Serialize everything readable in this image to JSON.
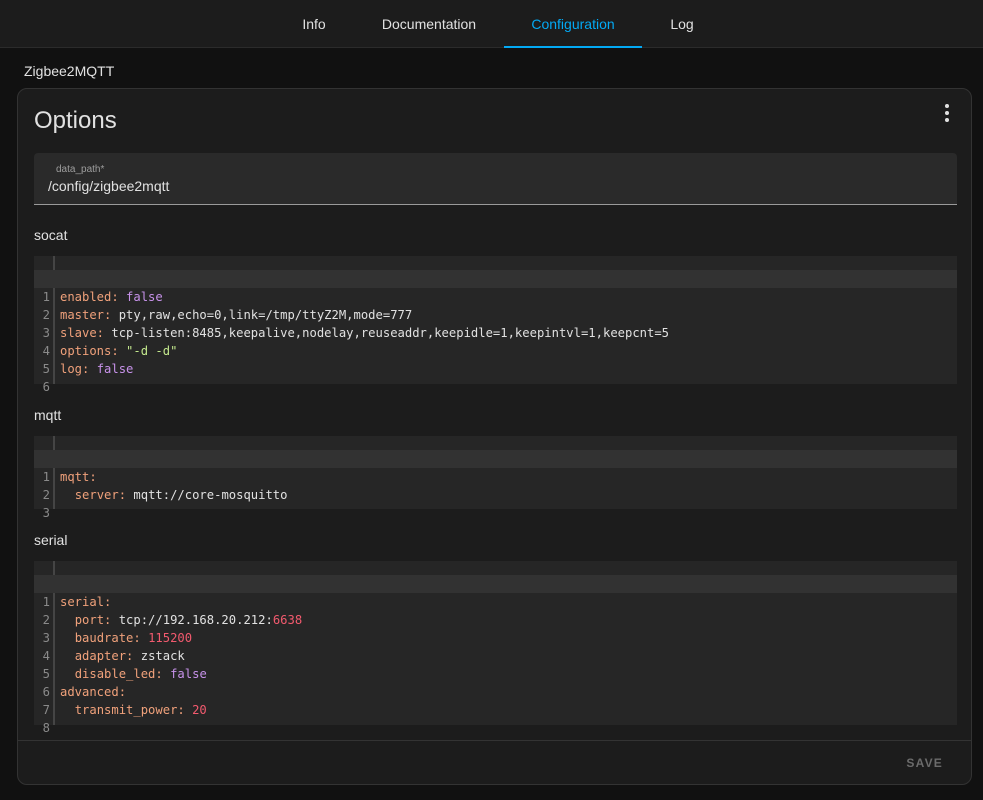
{
  "tabs": [
    {
      "label": "Info",
      "active": false
    },
    {
      "label": "Documentation",
      "active": false
    },
    {
      "label": "Configuration",
      "active": true
    },
    {
      "label": "Log",
      "active": false
    }
  ],
  "addon_name": "Zigbee2MQTT",
  "card": {
    "title": "Options",
    "menu_icon": "dots-vertical-icon",
    "data_path": {
      "label": "data_path*",
      "value": "/config/zigbee2mqtt"
    },
    "sections": [
      {
        "label": "socat",
        "lines": [
          "enabled: false",
          "master: pty,raw,echo=0,link=/tmp/ttyZ2M,mode=777",
          "slave: tcp-listen:8485,keepalive,nodelay,reuseaddr,keepidle=1,keepintvl=1,keepcnt=5",
          "options: \"-d -d\"",
          "log: false",
          ""
        ]
      },
      {
        "label": "mqtt",
        "lines": [
          "mqtt:",
          "  server: mqtt://core-mosquitto",
          ""
        ]
      },
      {
        "label": "serial",
        "lines": [
          "serial:",
          "  port: tcp://192.168.20.212:6638",
          "  baudrate: 115200",
          "  adapter: zstack",
          "  disable_led: false",
          "advanced:",
          "  transmit_power: 20",
          ""
        ]
      }
    ],
    "save_label": "SAVE"
  },
  "colors": {
    "accent": "#03a9f4",
    "yaml_key": "#f0a17b",
    "yaml_bool": "#c792ea",
    "yaml_number": "#f25a6e",
    "yaml_string": "#c3e88d"
  }
}
